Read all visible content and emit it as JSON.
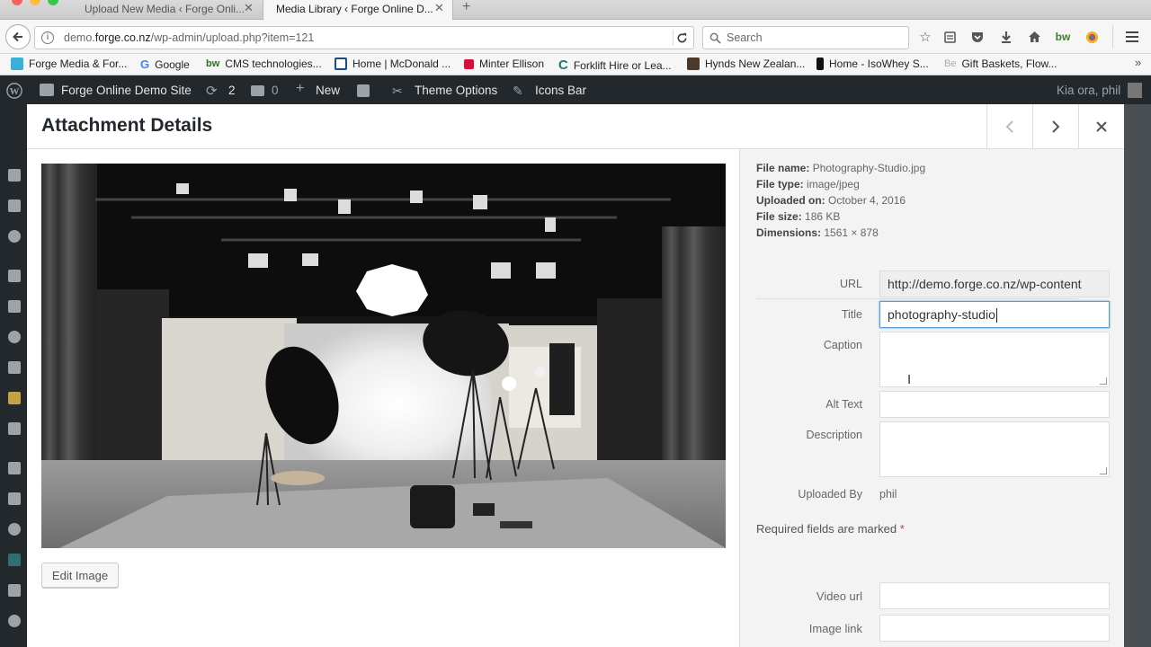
{
  "browser": {
    "tabs": [
      {
        "label": "Upload New Media ‹ Forge Onli..."
      },
      {
        "label": "Media Library ‹ Forge Online D..."
      }
    ],
    "url_prefix": "demo.",
    "url_domain": "forge.co.nz",
    "url_path": "/wp-admin/upload.php?item=121",
    "search_placeholder": "Search",
    "bookmarks": [
      {
        "label": "Forge Media & For..."
      },
      {
        "label": "Google"
      },
      {
        "label": "CMS technologies..."
      },
      {
        "label": "Home | McDonald ..."
      },
      {
        "label": "Minter Ellison"
      },
      {
        "label": "Forklift Hire or Lea..."
      },
      {
        "label": "Hynds New Zealan..."
      },
      {
        "label": "Home - IsoWhey S..."
      },
      {
        "label": "Gift Baskets, Flow..."
      }
    ]
  },
  "adminbar": {
    "site_name": "Forge Online Demo Site",
    "updates_count": "2",
    "comments_count": "0",
    "new_label": "New",
    "theme_options": "Theme Options",
    "icons_bar": "Icons Bar",
    "greeting": "Kia ora, phil"
  },
  "modal": {
    "title": "Attachment Details",
    "edit_image_label": "Edit Image",
    "info": {
      "file_name_label": "File name:",
      "file_name": "Photography-Studio.jpg",
      "file_type_label": "File type:",
      "file_type": "image/jpeg",
      "uploaded_on_label": "Uploaded on:",
      "uploaded_on": "October 4, 2016",
      "file_size_label": "File size:",
      "file_size": "186 KB",
      "dimensions_label": "Dimensions:",
      "dimensions": "1561 × 878"
    },
    "fields": {
      "url_label": "URL",
      "url_value": "http://demo.forge.co.nz/wp-content",
      "title_label": "Title",
      "title_value": "photography-studio",
      "caption_label": "Caption",
      "caption_value": "",
      "alt_label": "Alt Text",
      "alt_value": "",
      "description_label": "Description",
      "description_value": "",
      "uploaded_by_label": "Uploaded By",
      "uploaded_by_value": "phil",
      "required_note": "Required fields are marked",
      "required_star": "*",
      "video_url_label": "Video url",
      "video_url_value": "",
      "image_link_label": "Image link",
      "image_link_value": ""
    }
  }
}
